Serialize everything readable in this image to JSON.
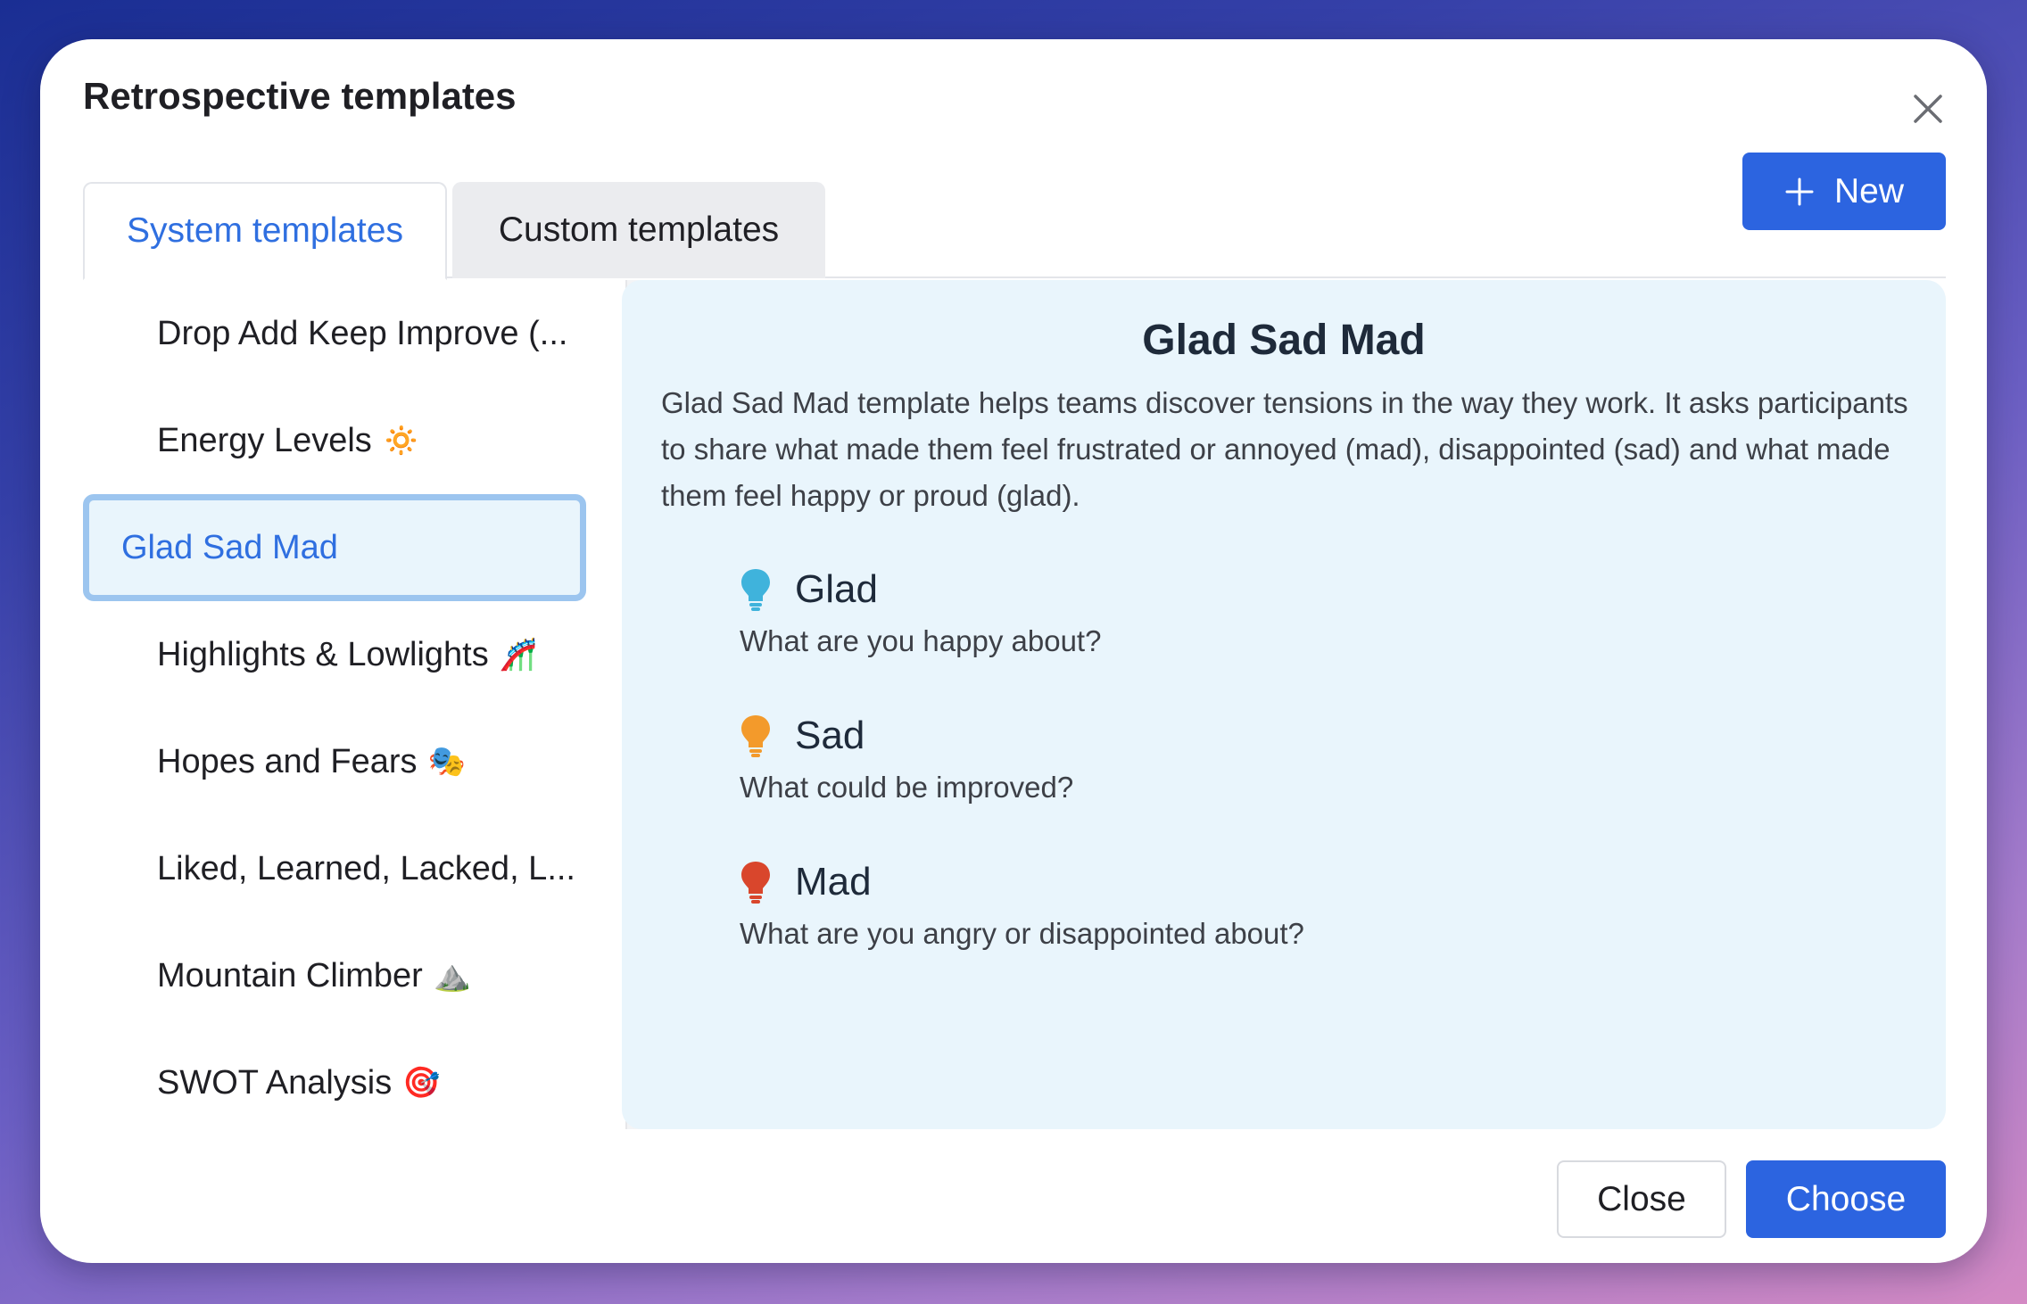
{
  "modal": {
    "title": "Retrospective templates"
  },
  "tabs": [
    {
      "label": "System templates",
      "active": true
    },
    {
      "label": "Custom templates",
      "active": false
    }
  ],
  "new_button": {
    "label": "New"
  },
  "templates": [
    {
      "label": "Drop Add Keep Improve (...",
      "emoji": ""
    },
    {
      "label": "Energy Levels",
      "emoji": "🔅"
    },
    {
      "label": "Glad Sad Mad",
      "emoji": "",
      "selected": true
    },
    {
      "label": "Highlights & Lowlights",
      "emoji": "🎢"
    },
    {
      "label": "Hopes and Fears",
      "emoji": "🎭"
    },
    {
      "label": "Liked, Learned, Lacked, L...",
      "emoji": ""
    },
    {
      "label": "Mountain Climber",
      "emoji": "⛰️"
    },
    {
      "label": "SWOT Analysis",
      "emoji": "🎯"
    }
  ],
  "preview": {
    "title": "Glad Sad Mad",
    "description": "Glad Sad Mad template helps teams discover tensions in the way they work. It asks participants to share what made them feel frustrated or annoyed (mad), disappointed (sad) and what made them feel happy or proud (glad).",
    "columns": [
      {
        "name": "Glad",
        "question": "What are you happy about?",
        "icon": "lightbulb-icon",
        "color": "#3fb3dc"
      },
      {
        "name": "Sad",
        "question": "What could be improved?",
        "icon": "lightbulb-icon",
        "color": "#f39a2b"
      },
      {
        "name": "Mad",
        "question": "What are you angry or disappointed about?",
        "icon": "lightbulb-icon",
        "color": "#d9462c"
      }
    ]
  },
  "footer": {
    "close_label": "Close",
    "choose_label": "Choose"
  },
  "colors": {
    "accent": "#2c64e0",
    "selected_bg": "#e9f5fc",
    "selected_border": "#9cc5ef"
  }
}
